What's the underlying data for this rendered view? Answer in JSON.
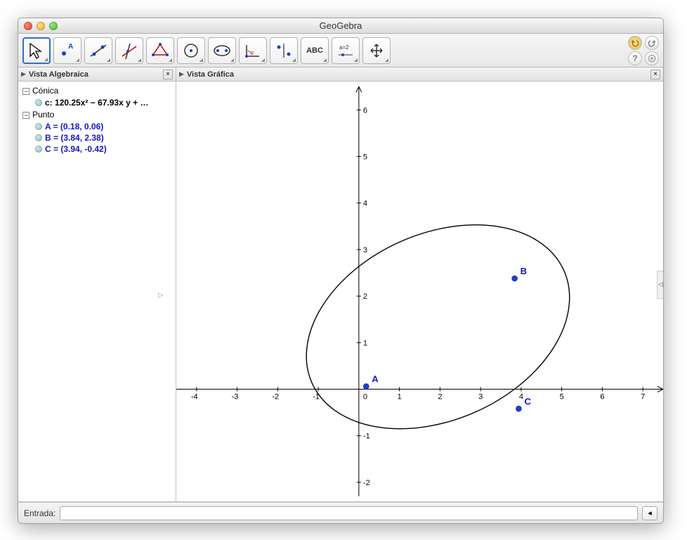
{
  "window": {
    "title": "GeoGebra"
  },
  "toolbar": {
    "tools": [
      {
        "name": "move-tool",
        "selected": true
      },
      {
        "name": "point-tool",
        "selected": false
      },
      {
        "name": "line-tool",
        "selected": false
      },
      {
        "name": "perpendicular-tool",
        "selected": false
      },
      {
        "name": "polygon-tool",
        "selected": false
      },
      {
        "name": "circle-tool",
        "selected": false
      },
      {
        "name": "ellipse-tool",
        "selected": false
      },
      {
        "name": "angle-tool",
        "selected": false
      },
      {
        "name": "reflect-tool",
        "selected": false
      },
      {
        "name": "text-tool",
        "selected": false,
        "label": "ABC"
      },
      {
        "name": "slider-tool",
        "selected": false,
        "label": "a=2"
      },
      {
        "name": "move-drag-tool",
        "selected": false
      }
    ]
  },
  "panels": {
    "algebra": {
      "title": "Vista Algebraica"
    },
    "graphics": {
      "title": "Vista Gráfica"
    }
  },
  "algebra": {
    "categories": [
      {
        "name": "Cónica",
        "items": [
          {
            "label": "c:",
            "value": "120.25x² − 67.93x y + …",
            "colorBlack": true
          }
        ]
      },
      {
        "name": "Punto",
        "items": [
          {
            "label": "A = (0.18, 0.06)"
          },
          {
            "label": "B = (3.84, 2.38)"
          },
          {
            "label": "C = (3.94, -0.42)"
          }
        ]
      }
    ]
  },
  "input": {
    "label": "Entrada:",
    "value": ""
  },
  "chart_data": {
    "type": "scatter",
    "title": "",
    "xlabel": "",
    "ylabel": "",
    "xlim": [
      -4.5,
      7.5
    ],
    "ylim": [
      -2.3,
      6.5
    ],
    "x_ticks": [
      -4,
      -3,
      -2,
      -1,
      0,
      1,
      2,
      3,
      4,
      5,
      6,
      7
    ],
    "y_ticks": [
      -2,
      -1,
      1,
      2,
      3,
      4,
      5,
      6
    ],
    "series": [
      {
        "name": "A",
        "x": 0.18,
        "y": 0.06
      },
      {
        "name": "B",
        "x": 3.84,
        "y": 2.38
      },
      {
        "name": "C",
        "x": 3.94,
        "y": -0.42
      }
    ],
    "conic": {
      "name": "c",
      "equation_prefix": "120.25x² − 67.93x y + …",
      "ellipse": {
        "cx": 1.95,
        "cy": 1.34,
        "rx": 3.4,
        "ry": 2.0,
        "rotation_deg": 24
      }
    }
  }
}
